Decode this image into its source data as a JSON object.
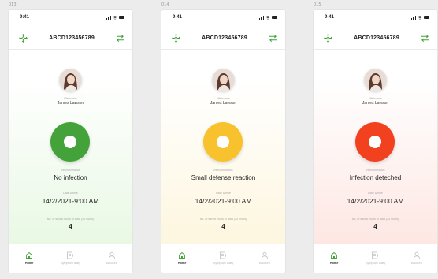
{
  "colors": {
    "page_background": "#ececec",
    "accent_green": "#43a33a",
    "inactive_icon": "#c4c4c4"
  },
  "frames": [
    {
      "tag": "013",
      "theme": {
        "ring": "#43a33a",
        "bg_top": "#ffffff",
        "bg_bottom": "#e9f8e4"
      },
      "status_time": "9:41",
      "device_id": "ABCD123456789",
      "welcome_label": "Welcome",
      "user_name": "James Lawson",
      "infection_status_label": "Infection status",
      "infection_status_value": "No infection",
      "date_label": "Date & time",
      "date_value": "14/2/2021-9:00 AM",
      "count_label": "No. of saved hours of data (24 hours)",
      "count_value": "4",
      "tabs": [
        {
          "label": "Home",
          "icon": "home-icon",
          "active": true
        },
        {
          "label": "Symptom diary",
          "icon": "diary-icon",
          "active": false
        },
        {
          "label": "Account",
          "icon": "account-icon",
          "active": false
        }
      ]
    },
    {
      "tag": "014",
      "theme": {
        "ring": "#f7c22e",
        "bg_top": "#ffffff",
        "bg_bottom": "#fdf6df"
      },
      "status_time": "9:41",
      "device_id": "ABCD123456789",
      "welcome_label": "Welcome",
      "user_name": "James Lawson",
      "infection_status_label": "Infection status",
      "infection_status_value": "Small defense reaction",
      "date_label": "Date & time",
      "date_value": "14/2/2021-9:00 AM",
      "count_label": "No. of saved hours of data (24 hours)",
      "count_value": "4",
      "tabs": [
        {
          "label": "Home",
          "icon": "home-icon",
          "active": true
        },
        {
          "label": "Symptom diary",
          "icon": "diary-icon",
          "active": false
        },
        {
          "label": "Account",
          "icon": "account-icon",
          "active": false
        }
      ]
    },
    {
      "tag": "015",
      "theme": {
        "ring": "#f2411f",
        "bg_top": "#ffffff",
        "bg_bottom": "#fde7e3"
      },
      "status_time": "9:41",
      "device_id": "ABCD123456789",
      "welcome_label": "Welcome",
      "user_name": "James Lawson",
      "infection_status_label": "Infection status",
      "infection_status_value": "Infection deteched",
      "date_label": "Date & time",
      "date_value": "14/2/2021-9:00 AM",
      "count_label": "No. of saved hours of data (24 hours)",
      "count_value": "4",
      "tabs": [
        {
          "label": "Home",
          "icon": "home-icon",
          "active": true
        },
        {
          "label": "Symptom diary",
          "icon": "diary-icon",
          "active": false
        },
        {
          "label": "Account",
          "icon": "account-icon",
          "active": false
        }
      ]
    }
  ]
}
